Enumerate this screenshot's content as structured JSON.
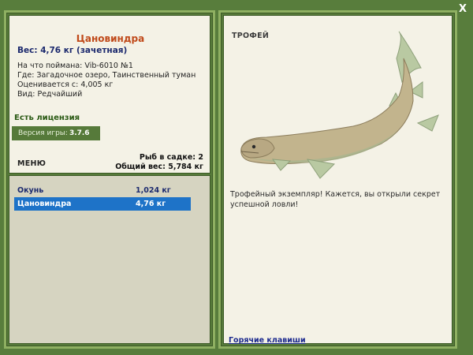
{
  "close_label": "X",
  "fish": {
    "name": "Цановиндра",
    "weight": "Вес: 4,76 кг (зачетная)",
    "caught_on": "На что поймана: Vib-6010 №1",
    "location": "Где: Загадочное озеро, Таинственный туман",
    "valued_from": "Оценивается с: 4,005 кг",
    "kind": "Вид: Редчайший"
  },
  "license": "Есть лицензия",
  "version": {
    "label": "Версия игры:",
    "value": "3.7.6"
  },
  "menu_label": "МЕНЮ",
  "cage": {
    "count": "Рыб в садке: 2",
    "total": "Общий вес: 5,784 кг"
  },
  "cage_list": [
    {
      "name": "Окунь",
      "weight": "1,024 кг"
    },
    {
      "name": "Цановиндра",
      "weight": "4,76 кг"
    }
  ],
  "trophy": {
    "label": "ТРОФЕЙ",
    "text": "Трофейный экземпляр! Кажется, вы открыли секрет успешной ловли!"
  },
  "hotkeys_label": "Горячие клавиши",
  "colors": {
    "frame": "#567a3a",
    "panel_bg": "#f4f2e6",
    "list_bg": "#d6d4c1",
    "selected": "#1e73c8",
    "fish_name": "#c04a1a"
  }
}
